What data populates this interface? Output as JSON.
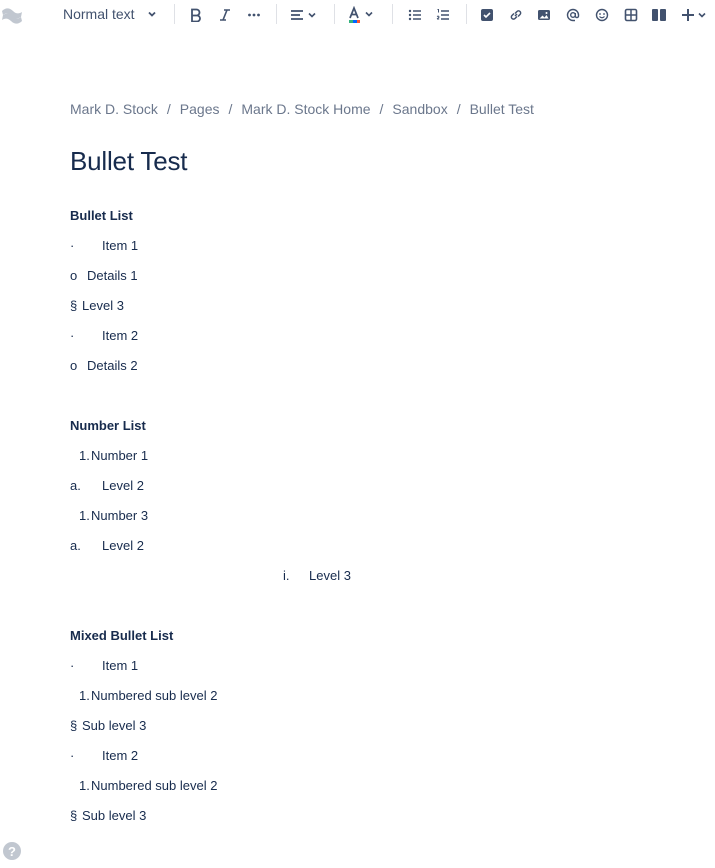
{
  "toolbar": {
    "text_style": "Normal text",
    "icons": [
      "confluence-logo-icon",
      "chevron-down-icon",
      "bold-icon",
      "italic-icon",
      "more-formatting-icon",
      "align-icon",
      "text-color-icon",
      "bullet-list-icon",
      "numbered-list-icon",
      "action-item-icon",
      "link-icon",
      "image-icon",
      "mention-icon",
      "emoji-icon",
      "table-icon",
      "layouts-icon",
      "insert-icon"
    ]
  },
  "breadcrumb": [
    "Mark D. Stock",
    "Pages",
    "Mark D. Stock Home",
    "Sandbox",
    "Bullet Test"
  ],
  "breadcrumb_separator": "/",
  "page": {
    "title": "Bullet Test",
    "sections": {
      "bullet": {
        "heading": "Bullet List",
        "lines": [
          {
            "marker": "·",
            "text": "Item 1"
          },
          {
            "marker": "o",
            "text": "Details 1"
          },
          {
            "marker": "§",
            "text": "Level 3"
          },
          {
            "marker": "·",
            "text": "Item 2"
          },
          {
            "marker": "o",
            "text": "Details 2"
          }
        ]
      },
      "number": {
        "heading": "Number List",
        "lines": [
          {
            "marker": "1.",
            "text": "Number 1"
          },
          {
            "marker": "a.",
            "text": "Level 2"
          },
          {
            "marker": "1.",
            "text": "Number 3"
          },
          {
            "marker": "a.",
            "text": "Level 2"
          },
          {
            "marker": "i.",
            "text": "Level 3"
          }
        ]
      },
      "mixed": {
        "heading": "Mixed Bullet List",
        "lines": [
          {
            "marker": "·",
            "text": "Item 1"
          },
          {
            "marker": "1.",
            "text": "Numbered sub level 2"
          },
          {
            "marker": "§",
            "text": "Sub level 3"
          },
          {
            "marker": "·",
            "text": "Item 2"
          },
          {
            "marker": "1.",
            "text": "Numbered sub level 2"
          },
          {
            "marker": "§",
            "text": "Sub level 3"
          }
        ]
      }
    }
  },
  "help": "?",
  "colors": {
    "text": "#172b4d",
    "secondary": "#6b778c",
    "icon": "#42526e"
  }
}
